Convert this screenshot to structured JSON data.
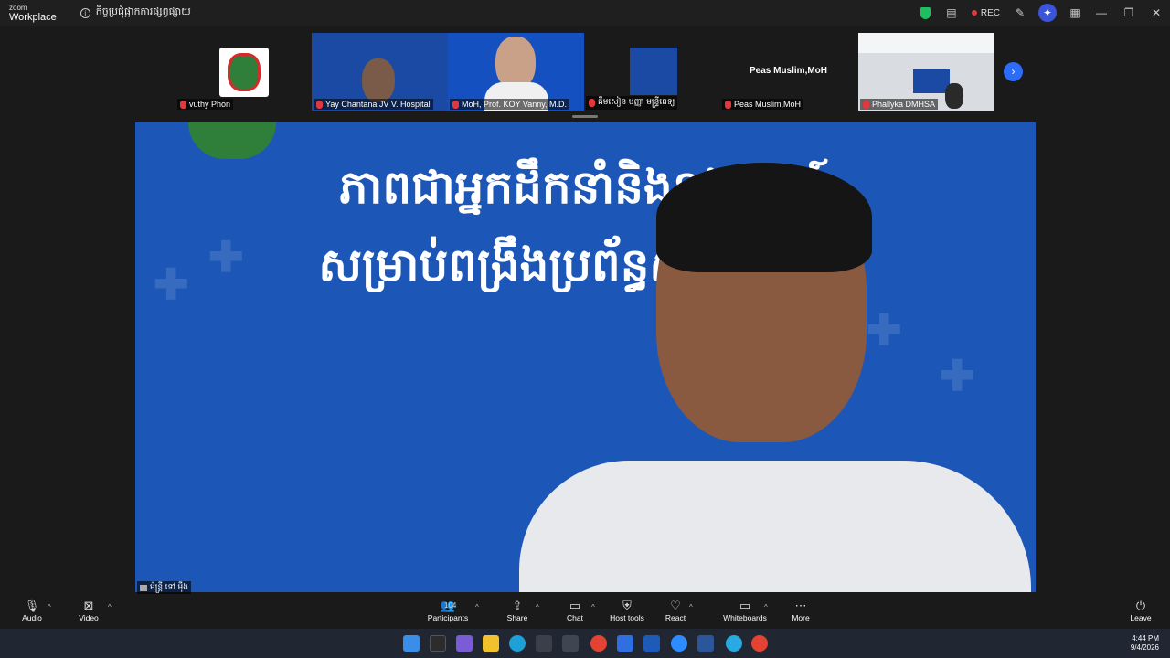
{
  "app": {
    "brand_top": "zoom",
    "brand_bottom": "Workplace",
    "meeting_title": "កិច្ចប្រជុំផ្អាកការផ្សព្វផ្សាយ",
    "rec_label": "REC"
  },
  "participants": [
    {
      "name": "vuthy Phon"
    },
    {
      "name": "Yay Chantana JV V. Hospital"
    },
    {
      "name": "MoH, Prof. KOY Vanny, M.D."
    },
    {
      "name": "គឹមសៀន បញ្ញា មន្ទ្រីពេទ្យ"
    },
    {
      "name": "Peas Muslim,MoH",
      "center_label": "Peas Muslim,MoH"
    },
    {
      "name": "Phallyka DMHSA"
    }
  ],
  "main_video": {
    "slide_line1": "ភាពជាអ្នកដឹកនាំនិងនវានុវត្តន៍",
    "slide_line2": "សម្រាប់ពង្រឹងប្រព័ន្ធសុខាភិបាល",
    "speaker_name": "ម៉ន្ត្រី ទៅ ម៉ឹង"
  },
  "controls": {
    "audio": "Audio",
    "video": "Video",
    "participants": "Participants",
    "participants_count": "104",
    "share": "Share",
    "chat": "Chat",
    "host_tools": "Host tools",
    "react": "React",
    "whiteboards": "Whiteboards",
    "more": "More",
    "leave": "Leave"
  },
  "taskbar": {
    "time": "4:44 PM",
    "date": "9/4/2026"
  },
  "colors": {
    "accent": "#2d6cf6",
    "slide_bg": "#1c57b8",
    "mute_red": "#e0383e"
  }
}
